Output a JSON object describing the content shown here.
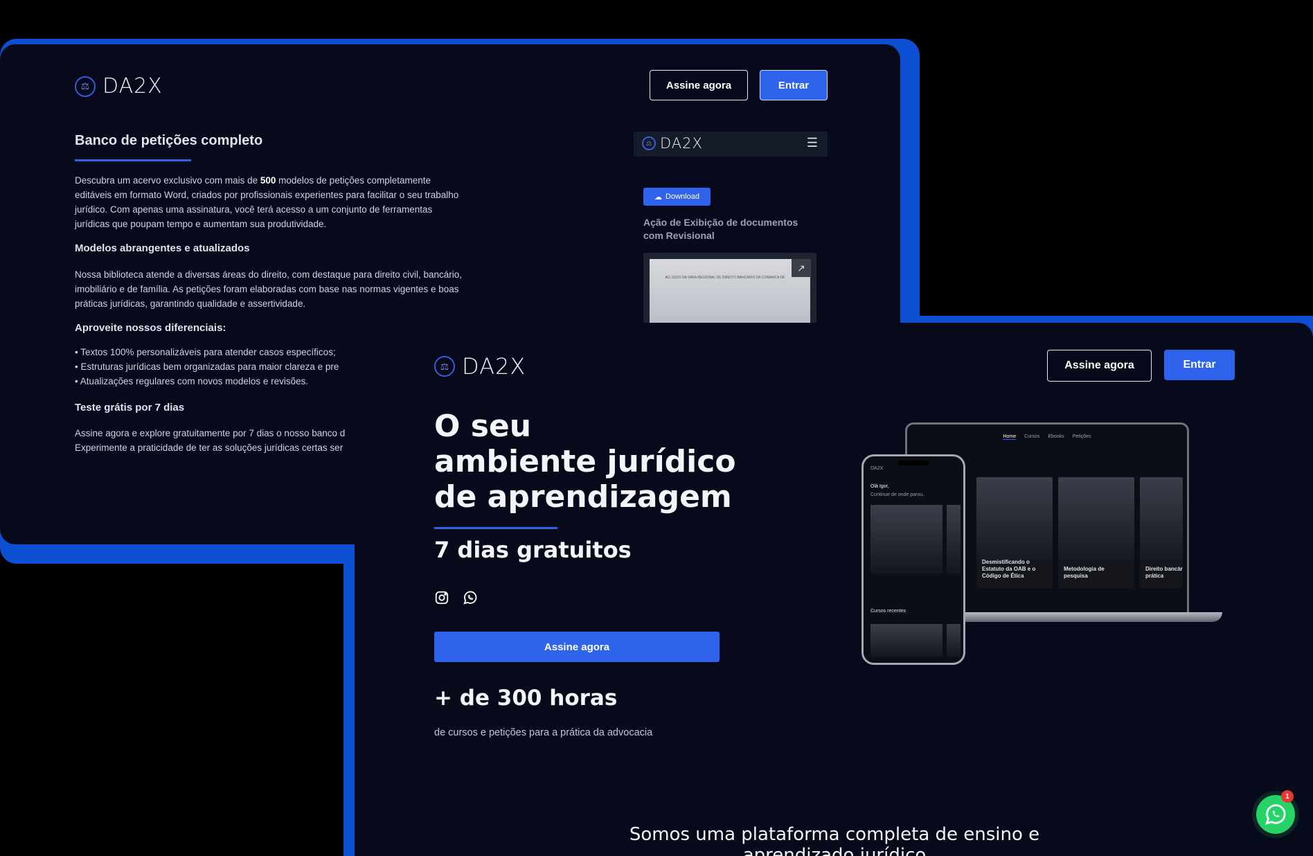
{
  "colors": {
    "accent": "#2f63ec",
    "frame": "#0c4fd3",
    "background": "#060a1a",
    "whatsapp": "#25d366"
  },
  "back_panel": {
    "logo": "DA2X",
    "buttons": {
      "subscribe": "Assine agora",
      "login": "Entrar"
    },
    "title": "Banco de petições completo",
    "intro_before": "Descubra um acervo exclusivo com mais de ",
    "intro_bold": "500",
    "intro_after": " modelos de petições completamente editáveis em formato Word, criados por profissionais experientes para facilitar o seu trabalho jurídico. Com apenas uma assinatura, você terá acesso a um conjunto de ferramentas jurídicas que poupam tempo e aumentam sua produtividade.",
    "section1_title": "Modelos abrangentes e atualizados",
    "section1_text": "Nossa biblioteca atende a diversas áreas do direito, com destaque para direito civil, bancário, imobiliário e de família. As petições foram elaboradas com base nas normas vigentes e boas práticas jurídicas, garantindo qualidade e assertividade.",
    "section2_title": "Aproveite nossos diferenciais:",
    "benefits": [
      "Textos 100% personalizáveis para atender casos específicos;",
      "Estruturas jurídicas bem organizadas para maior clareza e pre",
      "Atualizações regulares com novos modelos e revisões."
    ],
    "section3_title": "Teste grátis por 7 dias",
    "section3_text_line1": "Assine agora e explore gratuitamente por 7 dias o nosso banco d",
    "section3_text_line2": "Experimente a praticidade de ter as soluções jurídicas certas ser",
    "mobile_preview": {
      "logo": "DA2X",
      "download_label": "Download",
      "doc_title": "Ação de Exibição de documentos com Revisional",
      "doc_snippet": "AO JUÍZO DA VARA REGIONAL DE DIREITO BANCÁRIO DA COMARCA DE"
    }
  },
  "front_panel": {
    "logo": "DA2X",
    "buttons": {
      "subscribe": "Assine agora",
      "login": "Entrar"
    },
    "hero_line1": "O seu",
    "hero_line2": "ambiente jurídico",
    "hero_line3": "de aprendizagem",
    "hero_sub": "7 dias gratuitos",
    "cta": "Assine agora",
    "stat_title": "+ de 300 horas",
    "stat_desc": "de cursos e petições para a prática da advocacia",
    "about_line1": "Somos uma plataforma completa de ensino e",
    "about_line2": "aprendizado jurídico",
    "laptop_nav": [
      "Home",
      "Cursos",
      "Ebooks",
      "Petições"
    ],
    "laptop_cards": [
      "Desmistificando o Estatuto da OAB e o Código de Ética",
      "Metodologia de pesquisa",
      "Direito bancár prática"
    ],
    "phone_texts": {
      "logo": "DA2X",
      "greeting": "Olá Igor,",
      "continue": "Continue de onde parou.",
      "recent": "Cursos recentes"
    },
    "whatsapp_badge": "1"
  }
}
